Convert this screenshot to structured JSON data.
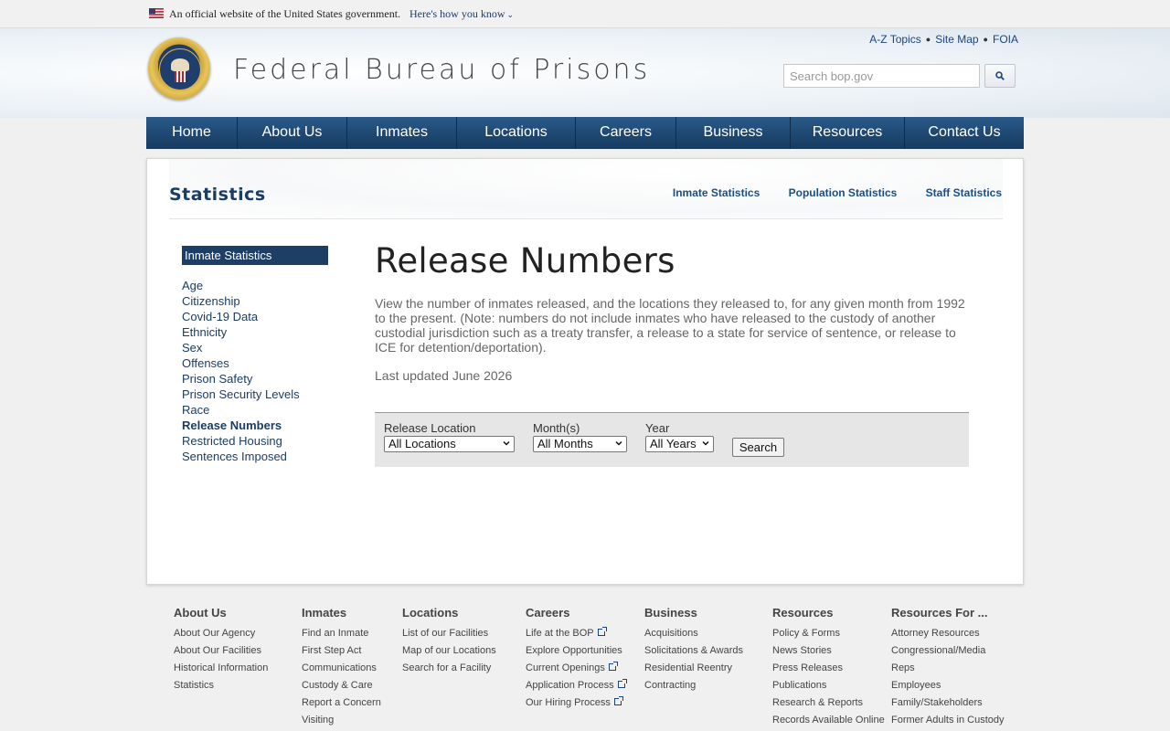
{
  "gov_banner": {
    "official_text": "An official website of the United States government.",
    "how_know_text": "Here's how you know"
  },
  "header": {
    "site_title": "Federal Bureau of Prisons",
    "util_links": [
      "A-Z Topics",
      "Site Map",
      "FOIA"
    ],
    "search_placeholder": "Search bop.gov"
  },
  "nav": {
    "items": [
      "Home",
      "About Us",
      "Inmates",
      "Locations",
      "Careers",
      "Business",
      "Resources",
      "Contact Us"
    ]
  },
  "section": {
    "title": "Statistics",
    "sub_links": [
      "Inmate Statistics",
      "Population Statistics",
      "Staff Statistics"
    ]
  },
  "sidebar": {
    "heading": "Inmate Statistics",
    "items": [
      "Age",
      "Citizenship",
      "Covid-19 Data",
      "Ethnicity",
      "Sex",
      "Offenses",
      "Prison Safety",
      "Prison Security Levels",
      "Race",
      "Release Numbers",
      "Restricted Housing",
      "Sentences Imposed"
    ],
    "active_item": "Release Numbers"
  },
  "main": {
    "title": "Release Numbers",
    "description": "View the number of inmates released, and the locations they released to, for any given month from 1992 to the present. (Note: numbers do not include inmates who have released to the custody of another custodial jurisdiction such as a treaty transfer, a release to a state for service of sentence, or release to ICE for detention/deportation).",
    "last_updated": "Last updated June 2026"
  },
  "form": {
    "location_label": "Release Location",
    "location_value": "All Locations",
    "month_label": "Month(s)",
    "month_value": "All Months",
    "year_label": "Year",
    "year_value": "All Years",
    "search_label": "Search"
  },
  "footer": {
    "columns": [
      {
        "heading": "About Us",
        "links": [
          "About Our Agency",
          "About Our Facilities",
          "Historical Information",
          "Statistics"
        ]
      },
      {
        "heading": "Inmates",
        "links": [
          "Find an Inmate",
          "First Step Act",
          "Communications",
          "Custody & Care",
          "Report a Concern",
          "Visiting"
        ]
      },
      {
        "heading": "Locations",
        "links": [
          "List of our Facilities",
          "Map of our Locations",
          "Search for a Facility"
        ]
      },
      {
        "heading": "Careers",
        "links": [
          "Life at the BOP",
          "Explore Opportunities",
          "Current Openings",
          "Application Process",
          "Our Hiring Process"
        ]
      },
      {
        "heading": "Business",
        "links": [
          "Acquisitions",
          "Solicitations & Awards",
          "Residential Reentry",
          "Contracting"
        ]
      },
      {
        "heading": "Resources",
        "links": [
          "Policy & Forms",
          "News Stories",
          "Press Releases",
          "Publications",
          "Research & Reports",
          "Records Available Online"
        ]
      },
      {
        "heading": "Resources For ...",
        "links": [
          "Attorney Resources",
          "Congressional/Media",
          "Reps",
          "Employees",
          "Family/Stakeholders",
          "Former Adults in Custody"
        ]
      }
    ]
  }
}
